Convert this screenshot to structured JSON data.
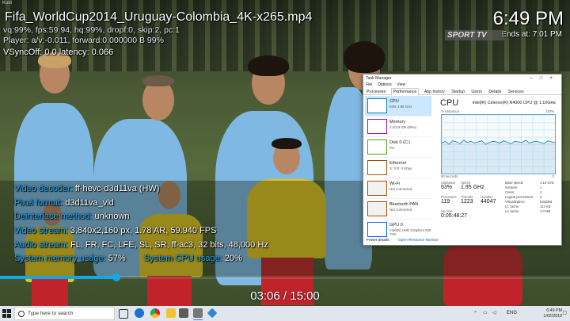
{
  "window": {
    "title": "Kodi"
  },
  "player": {
    "file_title": "Fifa_WorldCup2014_Uruguay-Colombia_4K-x265.mp4",
    "clock": "6:49 PM",
    "ends_at": "Ends at: 7:01 PM",
    "channel_logo": "SPORT TV",
    "debug_lines": [
      "vq:99%, fps:59.94, hq:99%, dropf:0, skip:2, pc:1",
      "Player: a/v:-0.011, forward:0.000000 B 99%",
      "VSyncOff: 0.0 latency: 0.066"
    ],
    "info": [
      {
        "label": "Video decoder:",
        "value": "ff-hevc-d3d11va (HW)"
      },
      {
        "label": "Pixel format:",
        "value": "d3d11va_vld"
      },
      {
        "label": "Deinterlace method:",
        "value": "unknown"
      },
      {
        "label": "Video stream:",
        "value": "3,840x2,160 px, 1.78 AR, 59.940 FPS"
      },
      {
        "label": "Audio stream:",
        "value": "FL, FR, FC, LFE, SL, SR, ff-ac3, 32 bits, 48,000 Hz"
      }
    ],
    "usage": {
      "mem_label": "System memory usage:",
      "mem_value": "57%",
      "cpu_label": "System CPU usage:",
      "cpu_value": "20%"
    },
    "progress": 0.204,
    "time_display": "03:06 / 15:00",
    "progress_color": "#12a8e8",
    "label_color": "#24a0e6"
  },
  "task_manager": {
    "title": "Task Manager",
    "menu": [
      "File",
      "Options",
      "View"
    ],
    "tabs": [
      "Processes",
      "Performance",
      "App history",
      "Startup",
      "Users",
      "Details",
      "Services"
    ],
    "active_tab": "Performance",
    "resources": [
      {
        "name": "CPU",
        "sub": "53% 1.95 GHz",
        "color": "#117dbb"
      },
      {
        "name": "Memory",
        "sub": "2.2/3.8 GB (58%)",
        "color": "#8b12ae"
      },
      {
        "name": "Disk 0 (C:)",
        "sub": "0%",
        "color": "#4da60c"
      },
      {
        "name": "Ethernet",
        "sub": "S: 0 R: 0 Kbps",
        "color": "#a74f01"
      },
      {
        "name": "Wi-Fi",
        "sub": "Not connected",
        "color": "#a74f01"
      },
      {
        "name": "Bluetooth PAN",
        "sub": "Not connected",
        "color": "#a74f01"
      },
      {
        "name": "GPU 0",
        "sub": "Intel(R) UHD Graphics 600\n70%",
        "color": "#0066ff"
      }
    ],
    "cpu_heading": "CPU",
    "cpu_model": "Intel(R) Celeron(R) N4000 CPU @ 1.10GHz",
    "graph_top_left": "% Utilization",
    "graph_top_right": "100%",
    "graph_bottom_left": "60 seconds",
    "graph_bottom_right": "0",
    "cpu_history": [
      52,
      55,
      50,
      56,
      54,
      51,
      57,
      53,
      55,
      52,
      54,
      56,
      50,
      53,
      55,
      54,
      52,
      56,
      53,
      51,
      55,
      54,
      53,
      57,
      52,
      54,
      55,
      53,
      51,
      56,
      54,
      53
    ],
    "stats": [
      {
        "label": "Utilization",
        "value": "53%"
      },
      {
        "label": "Speed",
        "value": "1.95 GHz"
      },
      {
        "label": "Processes",
        "value": "119"
      },
      {
        "label": "Threads",
        "value": "1223"
      },
      {
        "label": "Handles",
        "value": "44047"
      },
      {
        "label": "Up time",
        "value": "0:05:48:27"
      }
    ],
    "details": [
      {
        "k": "Base speed:",
        "v": "1.10 GHz"
      },
      {
        "k": "Sockets:",
        "v": "1"
      },
      {
        "k": "Cores:",
        "v": "2"
      },
      {
        "k": "Logical processors:",
        "v": "2"
      },
      {
        "k": "Virtualization:",
        "v": "Enabled"
      },
      {
        "k": "L1 cache:",
        "v": "112 KB"
      },
      {
        "k": "L2 cache:",
        "v": "4.0 MB"
      }
    ],
    "fewer_details": "Fewer details",
    "open_monitor": "Open Resource Monitor"
  },
  "taskbar": {
    "search_placeholder": "Type here to search",
    "icons": [
      "task-view",
      "edge",
      "chrome",
      "explorer",
      "store",
      "mail",
      "kodi",
      "photos"
    ],
    "language": "ENG",
    "time": "6:49 PM",
    "date": "1/02/2019"
  }
}
